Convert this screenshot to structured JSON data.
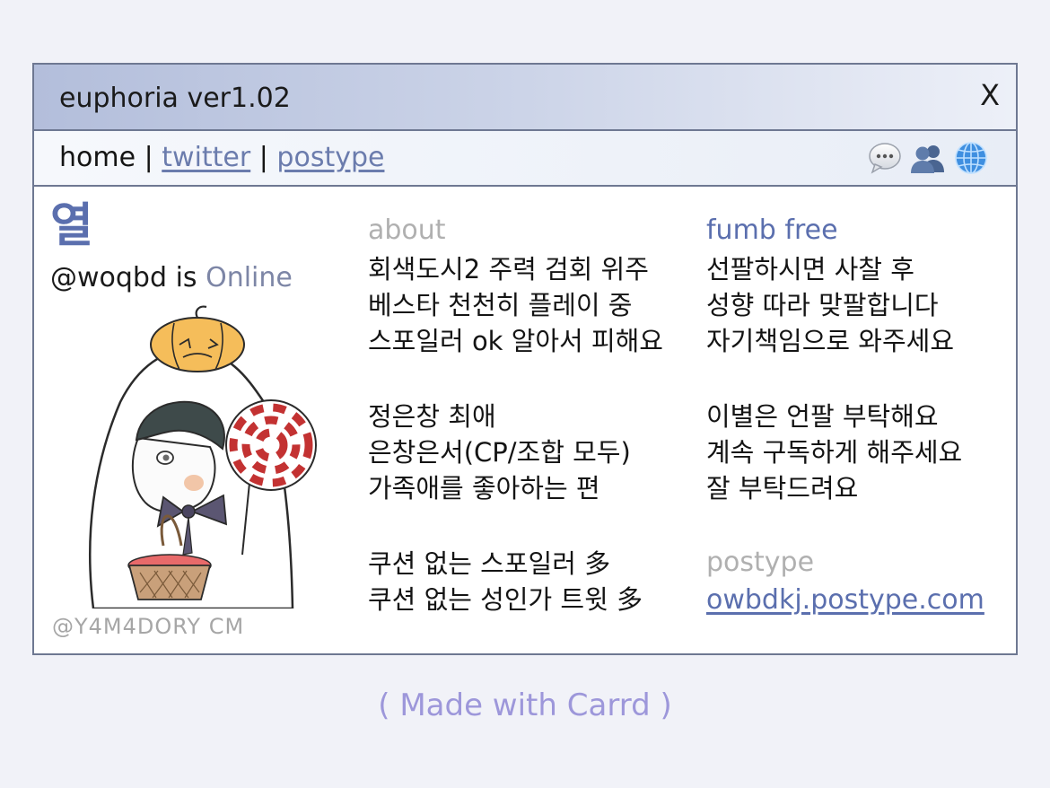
{
  "window": {
    "title": "euphoria ver1.02",
    "close_label": "X"
  },
  "nav": {
    "home": "home",
    "sep": "|",
    "twitter": "twitter",
    "postype": "postype",
    "icons": [
      "speech-bubble-icon",
      "people-icon",
      "globe-icon"
    ]
  },
  "profile": {
    "name": "열",
    "handle": "@woqbd",
    "is_text": " is ",
    "status": "Online",
    "credit": "@Y4M4DORY CM"
  },
  "about": {
    "heading": "about",
    "block1": [
      "회색도시2 주력 검회 위주",
      "베스타 천천히 플레이 중",
      "스포일러 ok 알아서 피해요"
    ],
    "block2": [
      "정은창 최애",
      "은창은서(CP/조합 모두)",
      "가족애를 좋아하는 편"
    ],
    "block3": [
      "쿠션 없는 스포일러 多",
      "쿠션 없는 성인가 트윗 多"
    ]
  },
  "fumb": {
    "heading": "fumb free",
    "block1": [
      "선팔하시면 사찰 후",
      "성향 따라 맞팔합니다",
      "자기책임으로 와주세요"
    ],
    "block2": [
      "이별은 언팔 부탁해요",
      "계속 구독하게 해주세요",
      "잘 부탁드려요"
    ],
    "postype_heading": "postype",
    "postype_link": "owbdkj.postype.com"
  },
  "footer": {
    "made_with": "( Made with Carrd )"
  },
  "colors": {
    "accent": "#5b6fae",
    "border": "#6e7892",
    "muted": "#b0b0b0",
    "footer": "#9d97da"
  }
}
